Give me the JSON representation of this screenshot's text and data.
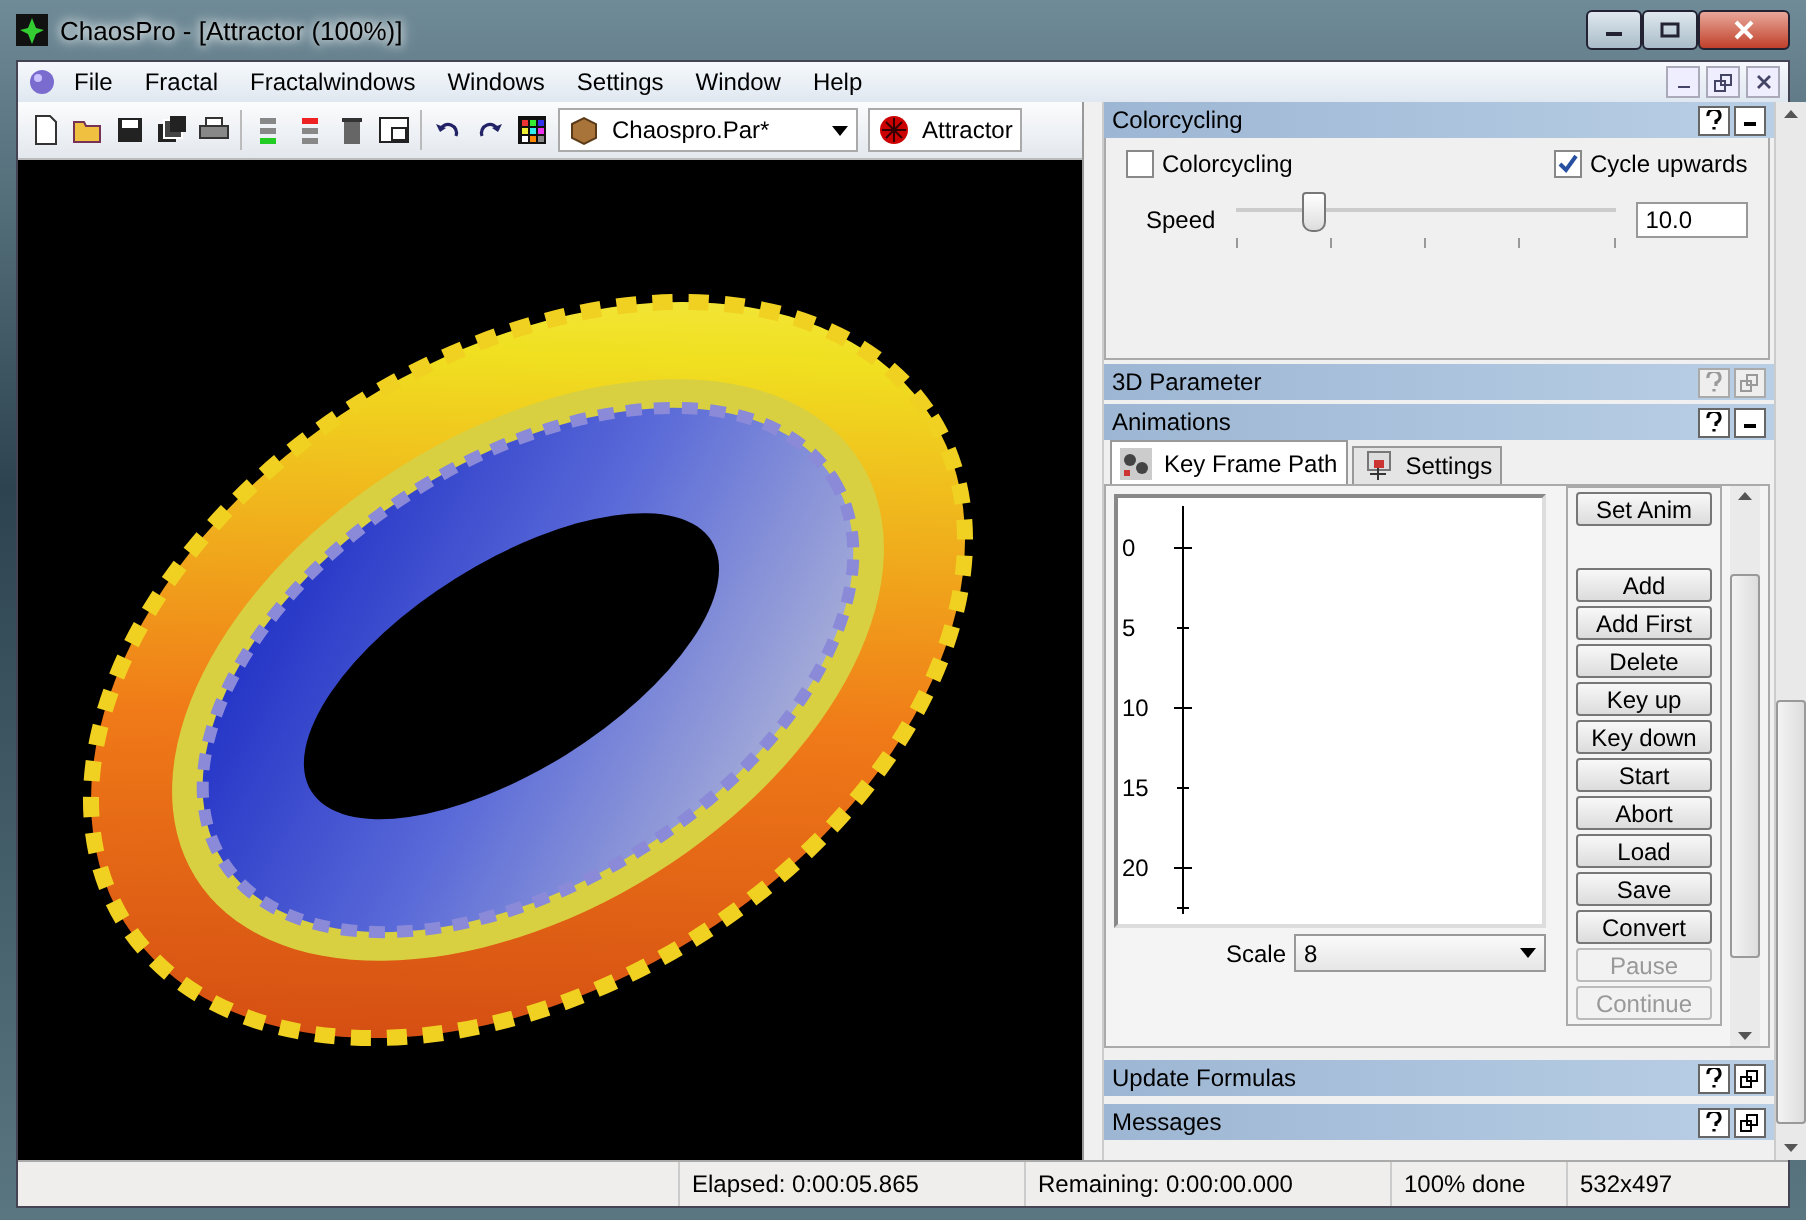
{
  "window": {
    "title": "ChaosPro - [Attractor (100%)]"
  },
  "menu": [
    "File",
    "Fractal",
    "Fractalwindows",
    "Windows",
    "Settings",
    "Window",
    "Help"
  ],
  "toolbar": {
    "document_dropdown": "Chaospro.Par*",
    "window_dropdown": "Attractor"
  },
  "colorcycling": {
    "title": "Colorcycling",
    "checkboxes": [
      {
        "label": "Colorcycling",
        "checked": false
      },
      {
        "label": "Cycle upwards",
        "checked": true
      }
    ],
    "speed": {
      "label": "Speed",
      "level": 0.2,
      "value": "10.0"
    }
  },
  "parameter_3d": {
    "title": "3D Parameter",
    "disabled": true
  },
  "animations": {
    "title": "Animations",
    "tabs": [
      {
        "label": "Key Frame Path",
        "selected": true
      },
      {
        "label": "Settings",
        "selected": false
      }
    ],
    "ruler_labels": [
      "0",
      "5",
      "10",
      "15",
      "20"
    ],
    "scale": {
      "label": "Scale",
      "value": "8"
    },
    "buttons": [
      {
        "label": "Set Anim",
        "disabled": false
      },
      {
        "label": "Add",
        "disabled": false
      },
      {
        "label": "Add First",
        "disabled": false
      },
      {
        "label": "Delete",
        "disabled": false
      },
      {
        "label": "Key up",
        "disabled": false
      },
      {
        "label": "Key down",
        "disabled": false
      },
      {
        "label": "Start",
        "disabled": false
      },
      {
        "label": "Abort",
        "disabled": false
      },
      {
        "label": "Load",
        "disabled": false
      },
      {
        "label": "Save",
        "disabled": false
      },
      {
        "label": "Convert",
        "disabled": false
      },
      {
        "label": "Pause",
        "disabled": true
      },
      {
        "label": "Continue",
        "disabled": true
      }
    ]
  },
  "collapsed_panels": [
    {
      "title": "Update Formulas"
    },
    {
      "title": "Messages"
    }
  ],
  "status_bar": [
    "Elapsed: 0:00:05.865",
    "Remaining: 0:00:00.000",
    "100% done",
    "532x497"
  ]
}
